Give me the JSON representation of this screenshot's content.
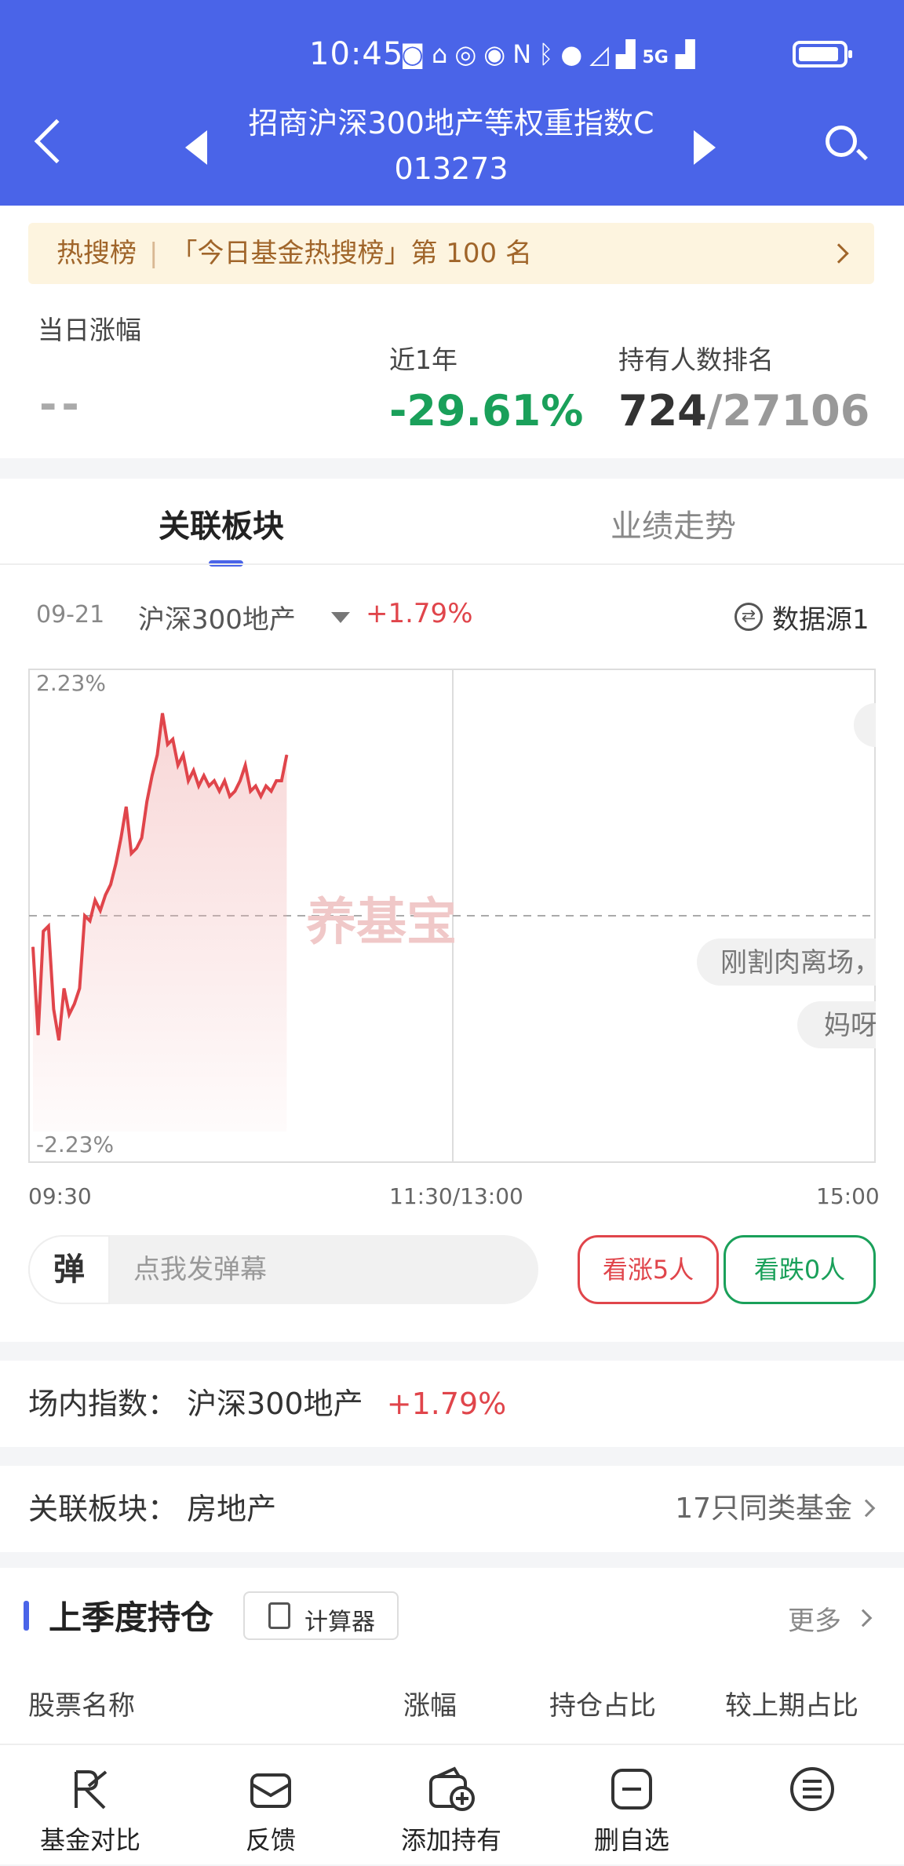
{
  "status_bar": {
    "time": "10:45",
    "network": "5G"
  },
  "header": {
    "title_line1": "招商沪深300地产等权重指数C",
    "title_line2": "013273"
  },
  "hot_bar": {
    "tag": "热搜榜",
    "text": "「今日基金热搜榜」第 100 名"
  },
  "stats": {
    "daily_label": "当日涨幅",
    "daily_value": "--",
    "year_label": "近1年",
    "year_value": "-29.61%",
    "rank_label": "持有人数排名",
    "rank_value": "724",
    "rank_total": "/27106"
  },
  "tabs": [
    {
      "label": "关联板块"
    },
    {
      "label": "业绩走势"
    }
  ],
  "chart_info": {
    "date": "09-21",
    "index": "沪深300地产",
    "change": "+1.79%",
    "source": "数据源1"
  },
  "chart_data": {
    "type": "line",
    "ylim": [
      -2.23,
      2.23
    ],
    "y_tick_labels": [
      "2.23%",
      "-2.23%"
    ],
    "x_tick_labels": [
      "09:30",
      "11:30/13:00",
      "15:00"
    ],
    "series": [
      {
        "values": [
          -0.3,
          -1.15,
          -0.15,
          -0.1,
          -0.9,
          -1.2,
          -0.7,
          -0.95,
          -0.85,
          -0.7,
          0.0,
          -0.05,
          0.15,
          0.05,
          0.2,
          0.3,
          0.5,
          0.75,
          1.05,
          0.6,
          0.65,
          0.75,
          1.1,
          1.35,
          1.55,
          1.95,
          1.65,
          1.7,
          1.45,
          1.55,
          1.3,
          1.4,
          1.25,
          1.35,
          1.25,
          1.3,
          1.2,
          1.3,
          1.15,
          1.2,
          1.3,
          1.45,
          1.2,
          1.25,
          1.15,
          1.25,
          1.2,
          1.3,
          1.3,
          1.55
        ]
      }
    ],
    "danmu": [
      "刚割肉离场，",
      "妈呀"
    ],
    "watermark": "养基宝"
  },
  "x_labels": [
    "09:30",
    "11:30/13:00",
    "15:00"
  ],
  "danmu_input": {
    "badge": "弹",
    "placeholder": "点我发弹幕"
  },
  "votes": {
    "up": "看涨5人",
    "down": "看跌0人"
  },
  "market_index": {
    "label": "场内指数：",
    "name": "沪深300地产",
    "change": "+1.79%"
  },
  "sector": {
    "label": "关联板块：",
    "name": "房地产",
    "link": "17只同类基金"
  },
  "holdings": {
    "title": "上季度持仓",
    "calculator": "计算器",
    "more": "更多",
    "columns": [
      "股票名称",
      "涨幅",
      "持仓占比",
      "较上期占比"
    ]
  },
  "bottom_nav": [
    {
      "label": "基金对比"
    },
    {
      "label": "反馈"
    },
    {
      "label": "添加持有"
    },
    {
      "label": "删自选"
    }
  ],
  "colors": {
    "primary": "#4a64e8",
    "up": "#e0454b",
    "down": "#1aa05a"
  }
}
